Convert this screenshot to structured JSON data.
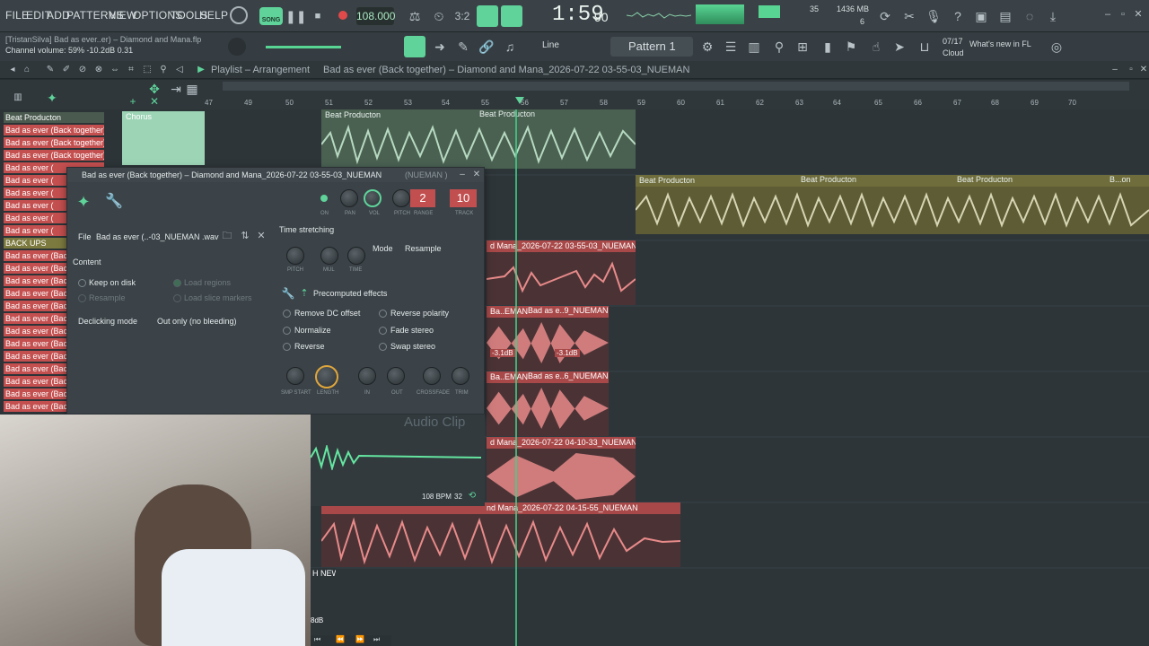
{
  "menu": [
    "FILE",
    "EDIT",
    "ADD",
    "PATTERNS",
    "VIEW",
    "OPTIONS",
    "TOOLS",
    "HELP"
  ],
  "transport": {
    "mode": "SONG",
    "tempo": "108.000",
    "time": "1:59",
    "time_sub": "90",
    "cpu": "35",
    "mem": "1436 MB",
    "voices": "6"
  },
  "hint": {
    "line1": "[TristanSilva]  Bad as ever..er) – Diamond and Mana.flp",
    "line2": "Channel volume: 59%  -10.2dB  0.31"
  },
  "snap": "Line",
  "pattern": "Pattern 1",
  "news": {
    "date": "07/17",
    "text": "What's new in FL Cloud"
  },
  "playlist": {
    "title": "Playlist – Arrangement",
    "breadcrumb": "Bad as ever (Back together) – Diamond and Mana_2026-07-22 03-55-03_NUEMAN",
    "ruler": [
      "47",
      "49",
      "50",
      "51",
      "52",
      "53",
      "54",
      "55",
      "56",
      "57",
      "58",
      "59",
      "60",
      "61",
      "62",
      "63",
      "64",
      "65",
      "66",
      "67",
      "68",
      "69",
      "70"
    ],
    "tracks": [
      "Beat Producton",
      "Bad as ever (Back together)..",
      "Bad as ever (Back together)..",
      "Bad as ever (Back together)..",
      "Bad as ever (",
      "Bad as ever (",
      "Bad as ever (",
      "Bad as ever (",
      "Bad as ever (",
      "Bad as ever (",
      "BACK UPS",
      "Bad as ever (Back",
      "Bad as ever (Back",
      "Bad as ever (Back",
      "Bad as ever (Back",
      "Bad as ever (Back",
      "Bad as ever (Back",
      "Bad as ever (Back",
      "Bad as ever (Back",
      "Bad as ever (Back",
      "Bad as ever (Back",
      "Bad as ever (Back",
      "Bad as ever (Back",
      "Bad as ever (Back"
    ],
    "chorus": "Chorus",
    "clips": {
      "beat1": "Beat Producton",
      "beat2": "Beat Producton",
      "beat3": "Beat Producton",
      "beat4": "Beat Producton",
      "beat5": "Beat Producton",
      "beat6": "B...on",
      "c1": "d Mana_2026-07-22 03-55-03_NUEMAN",
      "c2a": "Ba..EMAN",
      "c2b": "Bad as e..9_NUEMAN",
      "c3a": "Ba..EMAN",
      "c3b": "Bad as e..6_NUEMAN",
      "c4": "d Mana_2026-07-22 04-10-33_NUEMAN",
      "c5": "nd Mana_2026-07-22 04-15-55_NUEMAN",
      "c6": "H NEW",
      "db1": "-3.1dB",
      "db2": "-3.1dB",
      "db3": "8dB"
    }
  },
  "channel_dialog": {
    "title": "Bad as ever (Back together) – Diamond and Mana_2026-07-22 03-55-03_NUEMAN",
    "owner": "(NUEMAN )",
    "top_labels": [
      "ON",
      "PAN",
      "VOL",
      "PITCH",
      "RANGE",
      "TRACK"
    ],
    "pitch_range": "2",
    "track": "10",
    "file_label": "File",
    "file_name": "Bad as ever (..-03_NUEMAN .wav",
    "content": "Content",
    "keep_on_disk": "Keep on disk",
    "resample": "Resample",
    "load_regions": "Load regions",
    "load_slice": "Load slice markers",
    "declick_label": "Declicking mode",
    "declick_value": "Out only (no bleeding)",
    "time_stretching": "Time stretching",
    "ts_knobs": [
      "PITCH",
      "MUL",
      "TIME"
    ],
    "mode_label": "Mode",
    "mode_value": "Resample",
    "precomputed": "Precomputed effects",
    "effects": [
      "Remove DC offset",
      "Reverse polarity",
      "Normalize",
      "Fade stereo",
      "Reverse",
      "Swap stereo"
    ],
    "bottom_knobs": [
      "SMP START",
      "LENGTH",
      "IN",
      "OUT",
      "CROSSFADE",
      "TRIM"
    ],
    "type": "Audio Clip",
    "bpm": "108 BPM",
    "beats": "32"
  },
  "colors": {
    "accent": "#64e6a0",
    "clip_red": "#e88a8a",
    "clip_green": "#b7d9c1",
    "clip_olive": "#7c7a3e",
    "track_red": "#c44f4f"
  }
}
